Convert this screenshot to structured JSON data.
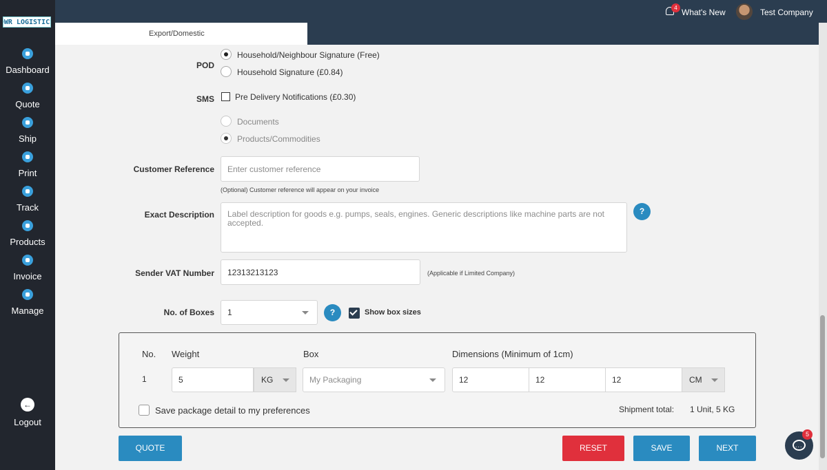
{
  "logo": {
    "text": "DWR LOGISTICS"
  },
  "sidebar": {
    "items": [
      {
        "label": "Dashboard",
        "icon": "dashboard-icon"
      },
      {
        "label": "Quote",
        "icon": "quote-icon"
      },
      {
        "label": "Ship",
        "icon": "ship-icon"
      },
      {
        "label": "Print",
        "icon": "print-icon"
      },
      {
        "label": "Track",
        "icon": "track-icon"
      },
      {
        "label": "Products",
        "icon": "products-icon"
      },
      {
        "label": "Invoice",
        "icon": "invoice-icon"
      },
      {
        "label": "Manage",
        "icon": "manage-icon"
      }
    ],
    "logout_label": "Logout"
  },
  "topbar": {
    "notification_count": "4",
    "whats_new": "What's New",
    "company": "Test Company"
  },
  "tabs": {
    "active": "Export/Domestic"
  },
  "form": {
    "pod": {
      "label": "POD",
      "options": [
        {
          "label": "Household/Neighbour Signature (Free)",
          "selected": true
        },
        {
          "label": "Household Signature (£0.84)",
          "selected": false
        }
      ]
    },
    "sms": {
      "label": "SMS",
      "option": "Pre Delivery Notifications (£0.30)",
      "checked": false
    },
    "content_type": {
      "options": [
        {
          "label": "Documents",
          "selected": false
        },
        {
          "label": "Products/Commodities",
          "selected": true
        }
      ]
    },
    "customer_reference": {
      "label": "Customer Reference",
      "placeholder": "Enter customer reference",
      "hint": "(Optional) Customer reference will appear on your invoice"
    },
    "exact_description": {
      "label": "Exact Description",
      "placeholder": "Label description for goods e.g. pumps, seals, engines. Generic descriptions like machine parts are not accepted.",
      "help": "?"
    },
    "sender_vat": {
      "label": "Sender VAT Number",
      "value": "12313213123",
      "hint": "(Applicable if Limited Company)"
    },
    "boxes": {
      "label": "No. of Boxes",
      "value": "1",
      "help": "?",
      "show_sizes_label": "Show box sizes",
      "show_sizes_checked": true
    }
  },
  "packages": {
    "headers": {
      "no": "No.",
      "weight": "Weight",
      "box": "Box",
      "dimensions": "Dimensions (Minimum of 1cm)"
    },
    "rows": [
      {
        "no": "1",
        "weight": "5",
        "weight_unit": "KG",
        "box_placeholder": "My Packaging",
        "length": "12",
        "width": "12",
        "height": "12",
        "dim_unit": "CM"
      }
    ],
    "save_pref_label": "Save package detail to my preferences",
    "total_label": "Shipment total:",
    "total_value": "1 Unit, 5 KG"
  },
  "buttons": {
    "quote": "QUOTE",
    "reset": "RESET",
    "save": "SAVE",
    "next": "NEXT"
  },
  "chat": {
    "badge": "5"
  },
  "colors": {
    "primary": "#2a8bc0",
    "danger": "#e0303c",
    "nav_bg": "#22262e",
    "header_bg": "#2b3d50"
  }
}
